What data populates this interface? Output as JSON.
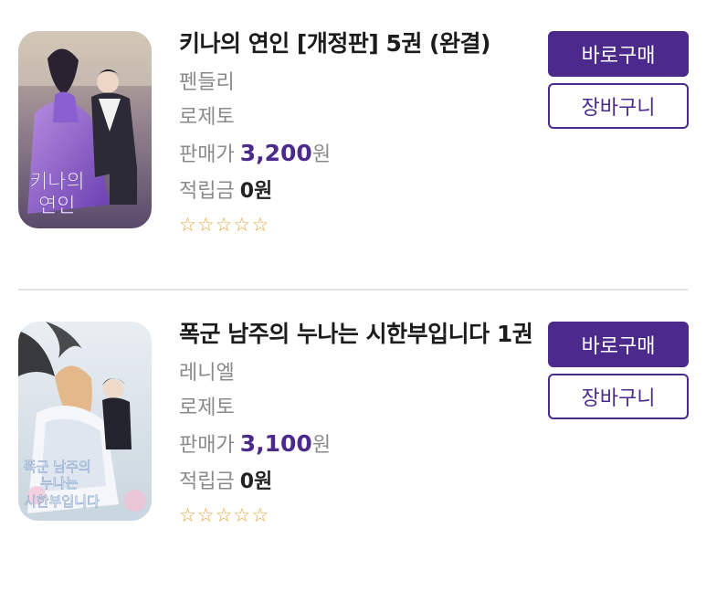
{
  "books": [
    {
      "title": "키나의 연인 [개정판] 5권 (완결)",
      "author": "펜들리",
      "publisher": "로제토",
      "price_label": "판매가",
      "price_value": "3,200",
      "price_unit": "원",
      "point_label": "적립금",
      "point_value": "0원",
      "stars": [
        "☆",
        "☆",
        "☆",
        "☆",
        "☆"
      ],
      "rating": 0,
      "buy_label": "바로구매",
      "cart_label": "장바구니",
      "cover_text": [
        "키나의",
        "연인"
      ]
    },
    {
      "title": "폭군 남주의 누나는 시한부입니다 1권",
      "author": "레니엘",
      "publisher": "로제토",
      "price_label": "판매가",
      "price_value": "3,100",
      "price_unit": "원",
      "point_label": "적립금",
      "point_value": "0원",
      "stars": [
        "☆",
        "☆",
        "☆",
        "☆",
        "☆"
      ],
      "rating": 0,
      "buy_label": "바로구매",
      "cart_label": "장바구니",
      "cover_text": [
        "폭군 남주의",
        "누나는",
        "시한부입니다"
      ]
    }
  ],
  "colors": {
    "accent": "#4b2a8c",
    "star": "#e7a53c",
    "muted_text": "#8a8a8a",
    "divider": "#e2e2e2"
  }
}
